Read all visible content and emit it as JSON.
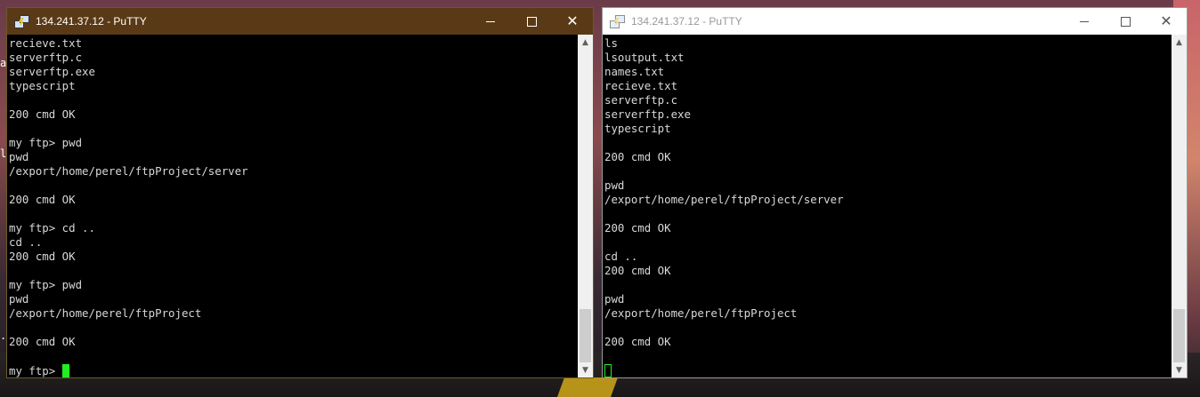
{
  "left_window": {
    "title": "134.241.37.12 - PuTTY",
    "lines": [
      "recieve.txt",
      "serverftp.c",
      "serverftp.exe",
      "typescript",
      "",
      "200 cmd OK",
      "",
      "my ftp> pwd",
      "pwd",
      "/export/home/perel/ftpProject/server",
      "",
      "200 cmd OK",
      "",
      "my ftp> cd ..",
      "cd ..",
      "200 cmd OK",
      "",
      "my ftp> pwd",
      "pwd",
      "/export/home/perel/ftpProject",
      "",
      "200 cmd OK",
      ""
    ],
    "prompt": "my ftp> "
  },
  "right_window": {
    "title": "134.241.37.12 - PuTTY",
    "lines": [
      "ls",
      "lsoutput.txt",
      "names.txt",
      "recieve.txt",
      "serverftp.c",
      "serverftp.exe",
      "typescript",
      "",
      "200 cmd OK",
      "",
      "pwd",
      "/export/home/perel/ftpProject/server",
      "",
      "200 cmd OK",
      "",
      "cd ..",
      "200 cmd OK",
      "",
      "pwd",
      "/export/home/perel/ftpProject",
      "",
      "200 cmd OK",
      ""
    ]
  },
  "window_buttons": {
    "minimize_icon": "minimize-icon",
    "maximize_icon": "maximize-icon",
    "close_glyph": "✕"
  },
  "scroll": {
    "up_arrow": "▲",
    "down_arrow": "▼"
  },
  "desktop_edge_glyphs": [
    "a",
    "le",
    "."
  ],
  "colors": {
    "active_titlebar": "#5a3a16",
    "inactive_titlebar": "#ffffff",
    "terminal_bg": "#000000",
    "terminal_text": "#d8d8d8",
    "cursor": "#22ee22"
  }
}
